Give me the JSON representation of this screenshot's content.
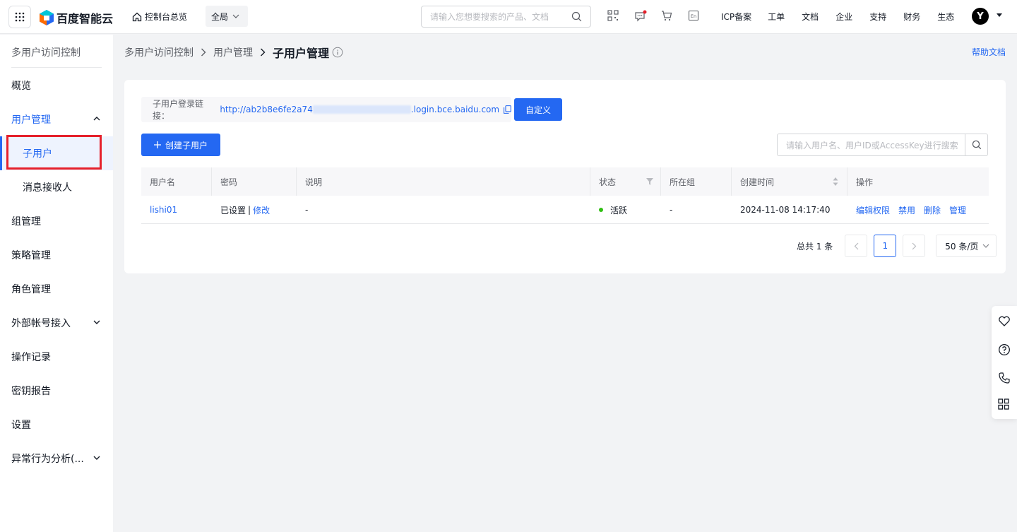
{
  "topbar": {
    "logo_text": "百度智能云",
    "home_label": "控制台总览",
    "region_label": "全局",
    "search_placeholder": "请输入您想要搜索的产品、文档",
    "nav": [
      "ICP备案",
      "工单",
      "文档",
      "企业",
      "支持",
      "财务",
      "生态"
    ],
    "avatar_letter": "Y",
    "icons": [
      "qrcode-icon",
      "message-icon",
      "cart-icon",
      "language-icon"
    ]
  },
  "sidebar": {
    "title": "多用户访问控制",
    "items": [
      {
        "label": "概览"
      },
      {
        "label": "用户管理"
      },
      {
        "label": "子用户"
      },
      {
        "label": "消息接收人"
      },
      {
        "label": "组管理"
      },
      {
        "label": "策略管理"
      },
      {
        "label": "角色管理"
      },
      {
        "label": "外部帐号接入"
      },
      {
        "label": "操作记录"
      },
      {
        "label": "密钥报告"
      },
      {
        "label": "设置"
      },
      {
        "label": "异常行为分析(..."
      }
    ]
  },
  "breadcrumb": {
    "items": [
      "多用户访问控制",
      "用户管理",
      "子用户管理"
    ]
  },
  "help_label": "帮助文档",
  "login_link": {
    "label": "子用户登录链接：",
    "url_prefix": "http://ab2b8e6fe2a74",
    "url_suffix": ".login.bce.baidu.com"
  },
  "customize_label": "自定义",
  "create_label": "创建子用户",
  "user_search_placeholder": "请输入用户名、用户ID或AccessKey进行搜索",
  "table": {
    "headers": [
      "用户名",
      "密码",
      "说明",
      "状态",
      "所在组",
      "创建时间",
      "操作"
    ],
    "rows": [
      {
        "username": "lishi01",
        "password_status": "已设置",
        "password_edit": "修改",
        "description": "-",
        "status": "活跃",
        "group": "-",
        "created": "2024-11-08 14:17:40",
        "ops": [
          "编辑权限",
          "禁用",
          "删除",
          "管理"
        ]
      }
    ]
  },
  "pager": {
    "total": "总共 1 条",
    "current_page": "1",
    "per_page": "50 条/页"
  },
  "colors": {
    "accent": "#2468f2",
    "active_status": "#30bf13",
    "highlight_box": "#e5202b"
  }
}
